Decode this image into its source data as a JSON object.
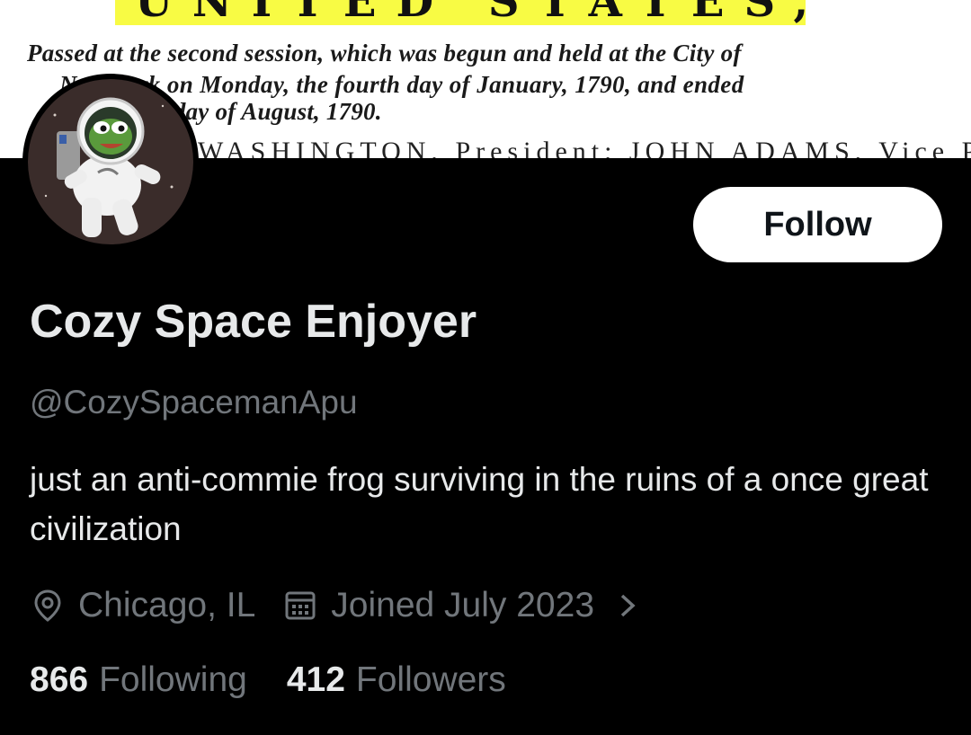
{
  "banner": {
    "headline": "UNITED STATES,",
    "lines": [
      "Passed at the second session, which was begun and held at the City of",
      "New-York on Monday, the fourth day of January, 1790, and ended",
      "the twelfth day of August, 1790.",
      "WASHINGTON, President; JOHN ADAMS, Vice President of the"
    ]
  },
  "profile": {
    "avatar_icon": "astronaut-frog-icon",
    "follow_label": "Follow",
    "display_name": "Cozy Space Enjoyer",
    "handle": "@CozySpacemanApu",
    "bio": "just an anti-commie frog surviving in the ruins of a once great civilization",
    "location": "Chicago, IL",
    "joined": "Joined July 2023",
    "following_count": "866",
    "following_label": "Following",
    "followers_count": "412",
    "followers_label": "Followers"
  },
  "colors": {
    "background": "#000000",
    "primary_text": "#e7e9ea",
    "secondary_text": "#71767b",
    "button_bg": "#ffffff",
    "banner_highlight": "#f8fb44"
  }
}
